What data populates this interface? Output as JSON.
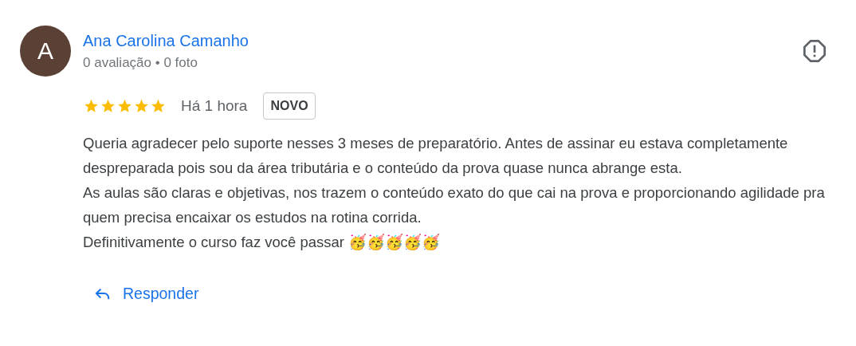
{
  "review": {
    "avatar_letter": "A",
    "author": "Ana Carolina Camanho",
    "author_meta": "0 avaliação • 0 foto",
    "stars": 5,
    "time": "Há 1 hora",
    "badge": "NOVO",
    "paragraphs": [
      "Queria agradecer pelo suporte nesses 3 meses de preparatório. Antes de assinar eu estava completamente despreparada pois sou da área tributária e o conteúdo da prova quase nunca abrange esta.",
      "As aulas são claras e objetivas, nos trazem o conteúdo exato do que cai na prova e proporcionando agilidade pra quem precisa encaixar os estudos na rotina corrida.",
      "Definitivamente o curso faz você passar 🥳🥳🥳🥳🥳"
    ],
    "reply_label": "Responder"
  }
}
